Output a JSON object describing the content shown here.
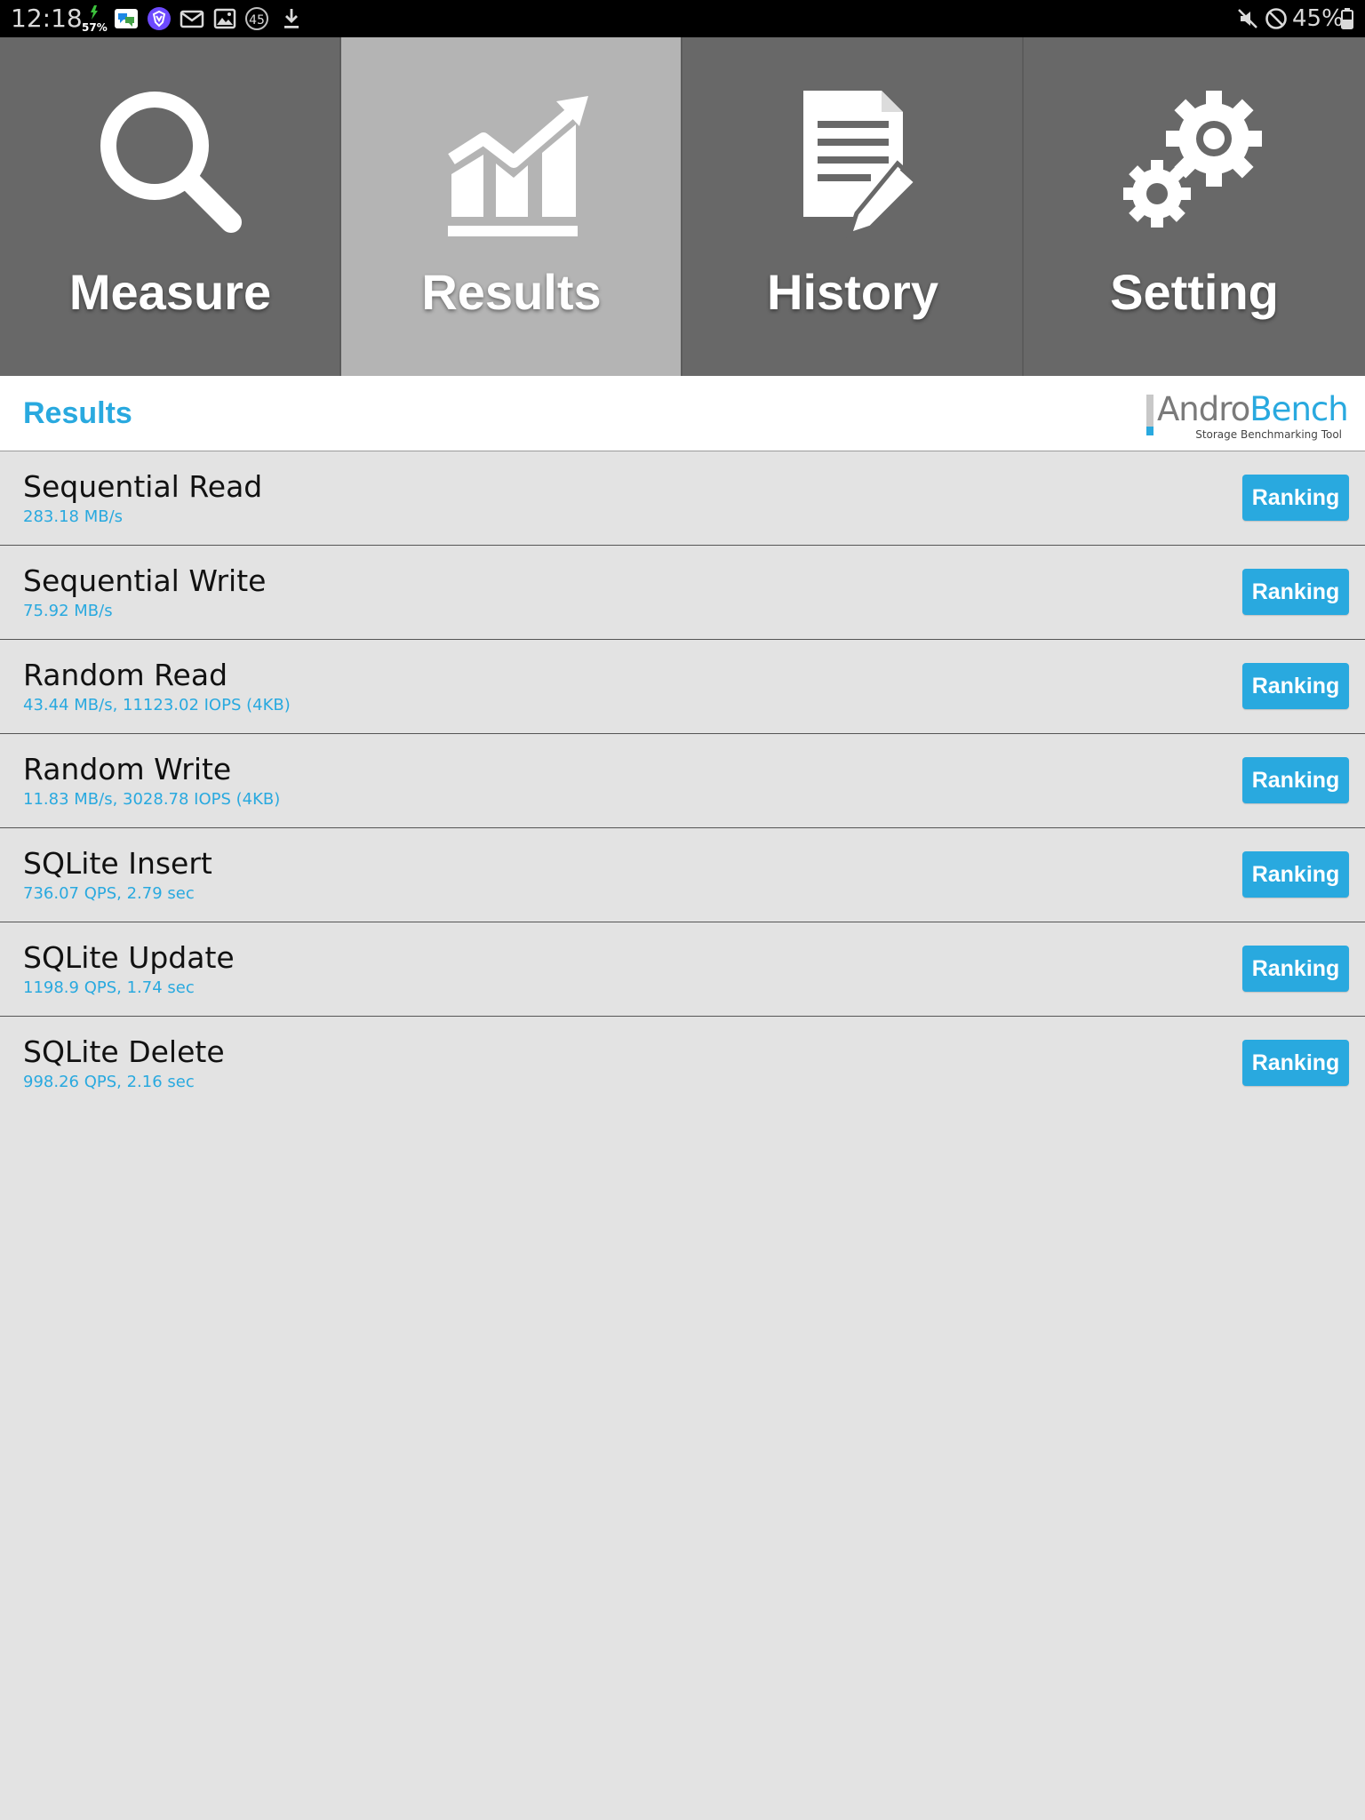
{
  "status_bar": {
    "time": "12:18",
    "data_saver_percent": "57%",
    "notification_count": "45",
    "battery_percent": "45%",
    "icons": [
      "data-usage-icon",
      "messages-app-icon",
      "proton-vpn-icon",
      "gmail-icon",
      "gallery-icon",
      "notification-count-icon",
      "download-icon",
      "mute-icon",
      "do-not-disturb-icon",
      "battery-icon"
    ]
  },
  "tabs": [
    {
      "label": "Measure",
      "icon": "magnifier-icon",
      "active": false
    },
    {
      "label": "Results",
      "icon": "chart-icon",
      "active": true
    },
    {
      "label": "History",
      "icon": "document-edit-icon",
      "active": false
    },
    {
      "label": "Setting",
      "icon": "gears-icon",
      "active": false
    }
  ],
  "header": {
    "title": "Results",
    "logo": {
      "name_part1": "Andro",
      "name_part2": "Bench",
      "tagline": "Storage Benchmarking Tool"
    }
  },
  "results": [
    {
      "title": "Sequential Read",
      "value": "283.18 MB/s",
      "button": "Ranking"
    },
    {
      "title": "Sequential Write",
      "value": "75.92 MB/s",
      "button": "Ranking"
    },
    {
      "title": "Random Read",
      "value": "43.44 MB/s, 11123.02 IOPS (4KB)",
      "button": "Ranking"
    },
    {
      "title": "Random Write",
      "value": "11.83 MB/s, 3028.78 IOPS (4KB)",
      "button": "Ranking"
    },
    {
      "title": "SQLite Insert",
      "value": "736.07 QPS, 2.79 sec",
      "button": "Ranking"
    },
    {
      "title": "SQLite Update",
      "value": "1198.9 QPS, 1.74 sec",
      "button": "Ranking"
    },
    {
      "title": "SQLite Delete",
      "value": "998.26 QPS, 2.16 sec",
      "button": "Ranking"
    }
  ],
  "colors": {
    "accent": "#29a9df",
    "tab_background": "#686868",
    "tab_active": "#b4b4b4",
    "list_background": "#e3e3e3"
  }
}
